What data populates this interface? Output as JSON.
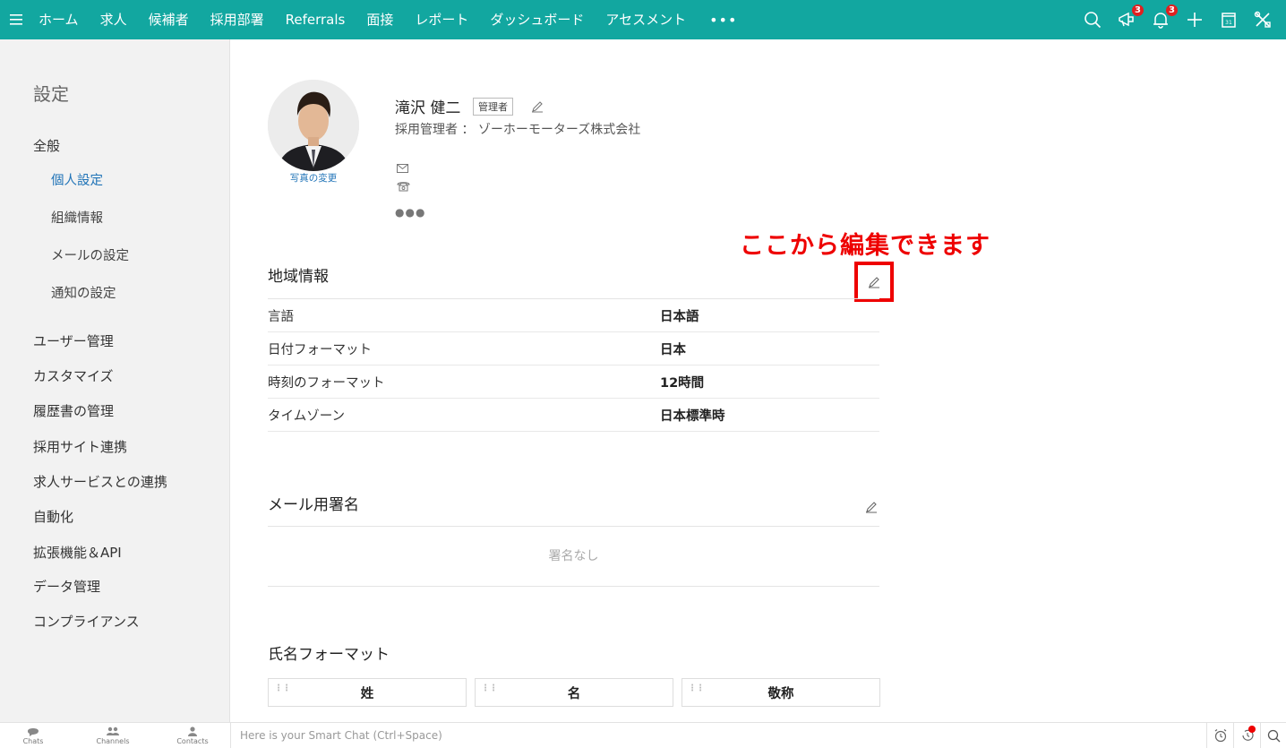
{
  "nav": {
    "items": [
      "ホーム",
      "求人",
      "候補者",
      "採用部署",
      "Referrals",
      "面接",
      "レポート",
      "ダッシュボード",
      "アセスメント"
    ],
    "more": "•••",
    "badges": {
      "announcements": "3",
      "notifications": "3"
    },
    "color": "#12a7a0"
  },
  "sidebar": {
    "title": "設定",
    "general": "全般",
    "sub_items": [
      "個人設定",
      "組織情報",
      "メールの設定",
      "通知の設定"
    ],
    "items": [
      "ユーザー管理",
      "カスタマイズ",
      "履歴書の管理",
      "採用サイト連携",
      "求人サービスとの連携",
      "自動化",
      "拡張機能＆API",
      "データ管理",
      "コンプライアンス"
    ]
  },
  "profile": {
    "name": "滝沢 健二",
    "role_badge": "管理者",
    "job": "採用管理者 ： ゾーホーモーターズ株式会社",
    "photo_change": "写真の変更"
  },
  "annotation": "ここから編集できます",
  "locale": {
    "title": "地域情報",
    "rows": [
      {
        "label": "言語",
        "value": "日本語"
      },
      {
        "label": "日付フォーマット",
        "value": "日本"
      },
      {
        "label": "時刻のフォーマット",
        "value": "12時間"
      },
      {
        "label": "タイムゾーン",
        "value": "日本標準時"
      }
    ]
  },
  "signature": {
    "title": "メール用署名",
    "empty": "署名なし"
  },
  "name_format": {
    "title": "氏名フォーマット",
    "fields": [
      "姓",
      "名",
      "敬称"
    ]
  },
  "bottom": {
    "tabs": [
      "Chats",
      "Channels",
      "Contacts"
    ],
    "smartchat_placeholder": "Here is your Smart Chat (Ctrl+Space)"
  }
}
